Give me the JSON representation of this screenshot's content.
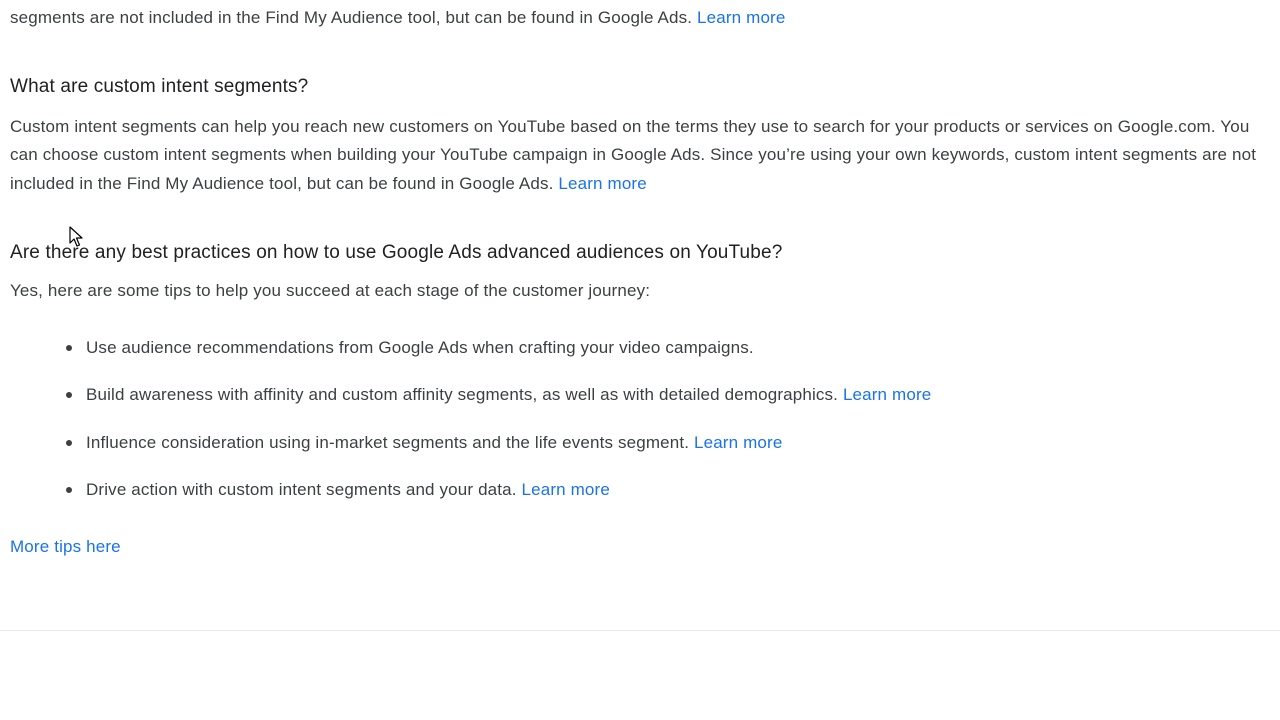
{
  "top_fragment": {
    "text": "segments are not included in the Find My Audience tool, but can be found in Google Ads.",
    "link": "Learn more"
  },
  "custom_intent": {
    "heading": "What are custom intent segments?",
    "body": "Custom intent segments can help you reach new customers on YouTube based on the terms they use to search for your products or services on Google.com. You can choose custom intent segments when building your YouTube campaign in Google Ads. Since you’re using your own keywords, custom intent segments are not included in the Find My Audience tool, but can be found in Google Ads.",
    "link": "Learn more"
  },
  "best_practices": {
    "heading": "Are there any best practices on how to use Google Ads advanced audiences on YouTube?",
    "intro": "Yes, here are some tips to help you succeed at each stage of the customer journey:",
    "tips": [
      {
        "text": "Use audience recommendations from Google Ads when crafting your video campaigns.",
        "link": ""
      },
      {
        "text": "Build awareness with affinity and custom affinity segments, as well as with detailed demographics.",
        "link": "Learn more"
      },
      {
        "text": "Influence consideration using in-market segments and the life events segment.",
        "link": "Learn more"
      },
      {
        "text": "Drive action with custom intent segments and your data.",
        "link": "Learn more"
      }
    ],
    "more_tips_link": "More tips here"
  },
  "icons": {
    "cursor": "mouse-pointer-icon"
  },
  "colors": {
    "link": "#1a73e8",
    "text": "#3c4043",
    "heading": "#202124"
  }
}
